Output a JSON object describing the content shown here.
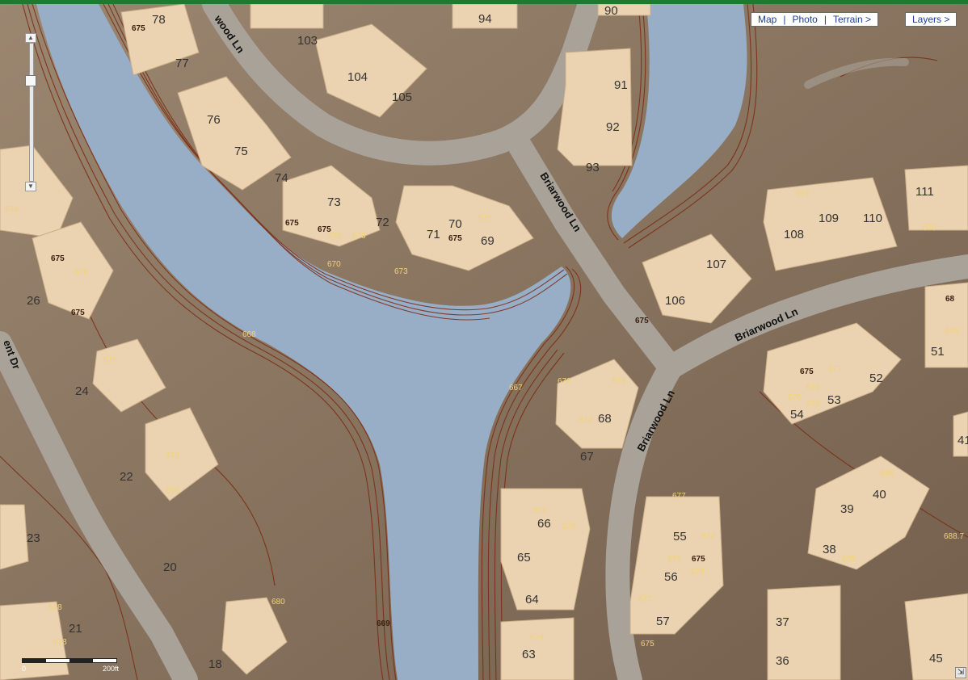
{
  "map_type_controls": {
    "map": "Map",
    "photo": "Photo",
    "terrain": "Terrain >",
    "layers": "Layers >"
  },
  "streets": {
    "top": "wood Ln",
    "diagonal": "Briarwood Ln",
    "east": "Briarwood Ln",
    "south": "Briarwood Ln",
    "west": "ent Dr"
  },
  "scale": {
    "start": "0",
    "end": "200ft"
  },
  "house_numbers": [
    "78",
    "77",
    "103",
    "94",
    "90",
    "104",
    "105",
    "91",
    "92",
    "93",
    "76",
    "75",
    "74",
    "73",
    "72",
    "71",
    "70",
    "69",
    "111",
    "108",
    "109",
    "110",
    "107",
    "106",
    "68",
    "67",
    "68",
    "51",
    "53",
    "52",
    "54",
    "41",
    "40",
    "39",
    "38",
    "66",
    "65",
    "64",
    "63",
    "55",
    "56",
    "57",
    "37",
    "36",
    "45",
    "26",
    "24",
    "22",
    "20",
    "23",
    "21",
    "18"
  ],
  "elevations": [
    "675",
    "676",
    "677",
    "678",
    "672",
    "673",
    "674",
    "670",
    "679",
    "680",
    "686",
    "688"
  ],
  "colors": {
    "water": "#98aec7",
    "road": "#a9a298",
    "house": "#ebd2b0",
    "terrain": "#8a7560",
    "contour": "#7a2a10",
    "elevation_label": "#f2d47a"
  }
}
